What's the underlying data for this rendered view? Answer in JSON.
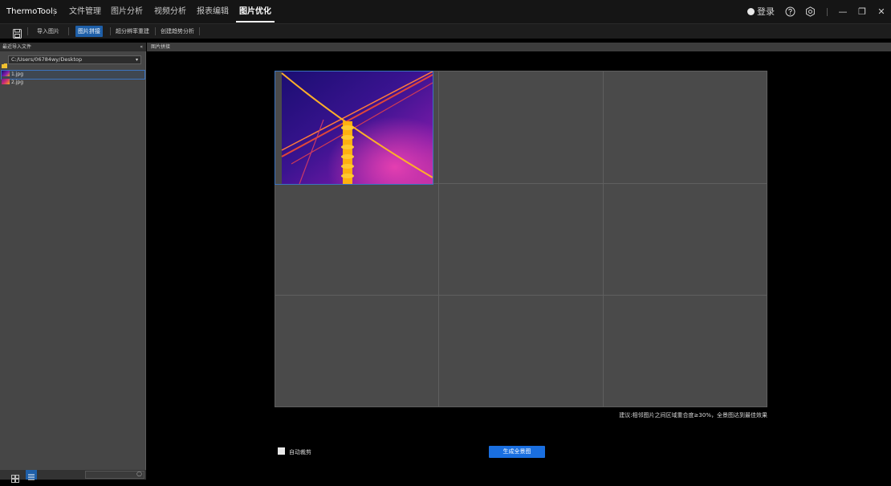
{
  "menubar": {
    "brand": "ThermoTools",
    "items": [
      "文件管理",
      "图片分析",
      "视频分析",
      "报表编辑",
      "图片优化"
    ],
    "active_index": 4,
    "login_label": "登录",
    "help_icon": "help-icon",
    "settings_icon": "gear-icon",
    "minimize_glyph": "—",
    "restore_glyph": "❐",
    "close_glyph": "✕"
  },
  "toolbar": {
    "items": [
      "导入图片",
      "图片拼接",
      "超分辨率重建",
      "创建趋势分析"
    ],
    "active_index": 1
  },
  "sidebar": {
    "header": "最近导入文件",
    "collapse_glyph": "«",
    "path": "C:/Users/06784wy/Desktop",
    "files": [
      "1.jpg",
      "2.jpg"
    ],
    "selected_index": 0
  },
  "content": {
    "header": "图片拼接",
    "hint": "建议:相邻图片之间区域重合度≥30%，全景图达到最佳效果",
    "auto_crop_label": "自动裁剪",
    "generate_label": "生成全景图"
  },
  "colors": {
    "accent": "#1a6fe0",
    "selection": "#3b73c0"
  }
}
